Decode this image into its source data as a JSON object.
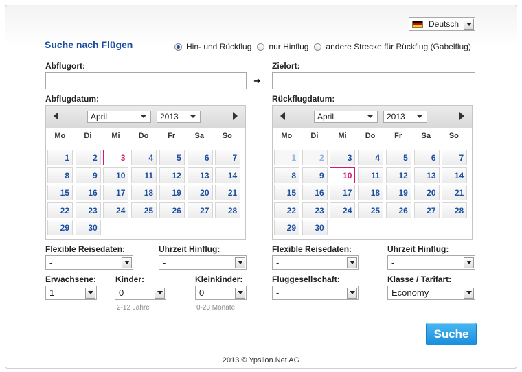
{
  "language": {
    "label": "Deutsch",
    "flag_icon": "german-flag-icon"
  },
  "title": "Suche nach Flügen",
  "trip_options": [
    {
      "label": "Hin- und Rückflug",
      "selected": true
    },
    {
      "label": "nur Hinflug",
      "selected": false
    },
    {
      "label": "andere Strecke für Rückflug (Gabelflug)",
      "selected": false
    }
  ],
  "origin": {
    "label": "Abflugort:",
    "value": ""
  },
  "destination": {
    "label": "Zielort:",
    "value": ""
  },
  "departure_calendar": {
    "label": "Abflugdatum:",
    "month": "April",
    "year": "2013",
    "weekdays": [
      "Mo",
      "Di",
      "Mi",
      "Do",
      "Fr",
      "Sa",
      "So"
    ],
    "highlighted_day": 3,
    "days": [
      "1",
      "2",
      "3",
      "4",
      "5",
      "6",
      "7",
      "8",
      "9",
      "10",
      "11",
      "12",
      "13",
      "14",
      "15",
      "16",
      "17",
      "18",
      "19",
      "20",
      "21",
      "22",
      "23",
      "24",
      "25",
      "26",
      "27",
      "28",
      "29",
      "30"
    ]
  },
  "return_calendar": {
    "label": "Rückflugdatum:",
    "month": "April",
    "year": "2013",
    "weekdays": [
      "Mo",
      "Di",
      "Mi",
      "Do",
      "Fr",
      "Sa",
      "So"
    ],
    "highlighted_day": 10,
    "past_days": [
      1,
      2
    ],
    "days": [
      "1",
      "2",
      "3",
      "4",
      "5",
      "6",
      "7",
      "8",
      "9",
      "10",
      "11",
      "12",
      "13",
      "14",
      "15",
      "16",
      "17",
      "18",
      "19",
      "20",
      "21",
      "22",
      "23",
      "24",
      "25",
      "26",
      "27",
      "28",
      "29",
      "30"
    ]
  },
  "left_options": {
    "flex_label": "Flexible Reisedaten:",
    "flex_value": "-",
    "time_label": "Uhrzeit Hinflug:",
    "time_value": "-",
    "adults_label": "Erwachsene:",
    "adults_value": "1",
    "children_label": "Kinder:",
    "children_value": "0",
    "children_hint": "2-12 Jahre",
    "infants_label": "Kleinkinder:",
    "infants_value": "0",
    "infants_hint": "0-23 Monate"
  },
  "right_options": {
    "flex_label": "Flexible Reisedaten:",
    "flex_value": "-",
    "time_label": "Uhrzeit Hinflug:",
    "time_value": "-",
    "airline_label": "Fluggesellschaft:",
    "airline_value": "-",
    "class_label": "Klasse / Tarifart:",
    "class_value": "Economy"
  },
  "search_button": "Suche",
  "footer": "2013 © Ypsilon.Net AG"
}
